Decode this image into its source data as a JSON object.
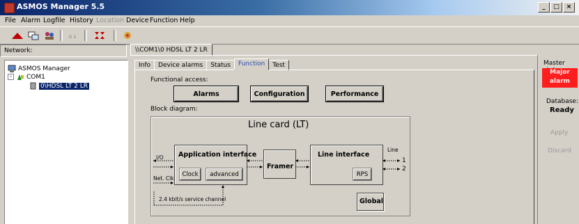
{
  "window": {
    "title": "ASMOS Manager 5.5",
    "controls": [
      "_",
      "×",
      "×"
    ]
  },
  "menu": [
    "File",
    "Alarm",
    "Logfile",
    "History",
    "Location",
    "Device",
    "Function",
    "Help"
  ],
  "network": {
    "label": "Network:",
    "tree": {
      "root": "ASMOS Manager",
      "com": "COM1",
      "device": "0\\HDSL LT 2 LR"
    }
  },
  "doc_tab": "\\\\COM1\\0 HDSL LT 2 LR",
  "tabs": [
    "Info",
    "Device alarms",
    "Status",
    "Function",
    "Test"
  ],
  "functional": {
    "label": "Functional access:",
    "buttons": {
      "alarms": "Alarms",
      "configuration": "Configuration",
      "performance": "Performance"
    }
  },
  "block": {
    "label": "Block diagram:",
    "title": "Line card (LT)",
    "app_interface": "Application interface",
    "clock": "Clock",
    "advanced": "advanced",
    "framer": "Framer",
    "line_interface": "Line interface",
    "rps": "RPS",
    "global": "Global",
    "io": "I/O",
    "netclk": "Net. Clk",
    "line": "Line",
    "line1": "1",
    "line2": "2",
    "service": "2.4 kbit/s service channel"
  },
  "right": {
    "master_label": "Master state",
    "major": "Major alarm",
    "db_label": "Database:",
    "db_value": "Ready",
    "apply": "Apply",
    "discard": "Discard"
  }
}
